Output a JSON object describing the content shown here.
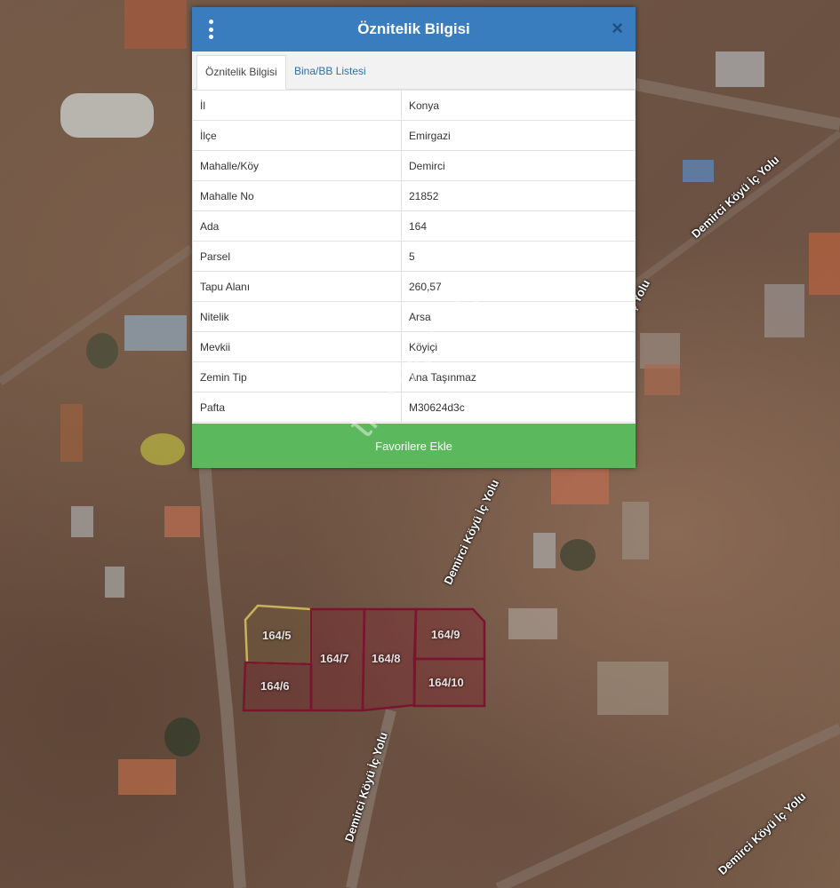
{
  "dialog": {
    "title": "Öznitelik Bilgisi",
    "close_symbol": "×",
    "menu_icon": "vertical-dots-icon",
    "tabs": [
      {
        "label": "Öznitelik Bilgisi",
        "active": true
      },
      {
        "label": "Bina/BB Listesi",
        "active": false
      }
    ],
    "rows": [
      {
        "key": "İl",
        "value": "Konya"
      },
      {
        "key": "İlçe",
        "value": "Emirgazi"
      },
      {
        "key": "Mahalle/Köy",
        "value": "Demirci"
      },
      {
        "key": "Mahalle No",
        "value": "21852"
      },
      {
        "key": "Ada",
        "value": "164"
      },
      {
        "key": "Parsel",
        "value": "5"
      },
      {
        "key": "Tapu Alanı",
        "value": "260,57"
      },
      {
        "key": "Nitelik",
        "value": "Arsa"
      },
      {
        "key": "Mevkii",
        "value": "Köyiçi"
      },
      {
        "key": "Zemin Tip",
        "value": "Ana Taşınmaz"
      },
      {
        "key": "Pafta",
        "value": "M30624d3c"
      }
    ],
    "favorite_button_label": "Favorilere Ekle"
  },
  "map": {
    "road_labels": [
      "Demirci Köyü İç Yolu",
      "İç Yolu",
      "Demirci Köyü İç Yolu",
      "Demirci Köyü İç Yolu",
      "Demirci Köyü İç Yolu"
    ],
    "parcels": [
      "164/5",
      "164/6",
      "164/7",
      "164/8",
      "164/9",
      "164/10"
    ],
    "watermark": "trarsa.com"
  },
  "colors": {
    "header": "#3a7dbe",
    "button": "#5cb85c",
    "parcel_stroke": "#7a1530",
    "selected_parcel_stroke": "#c9b35a"
  }
}
